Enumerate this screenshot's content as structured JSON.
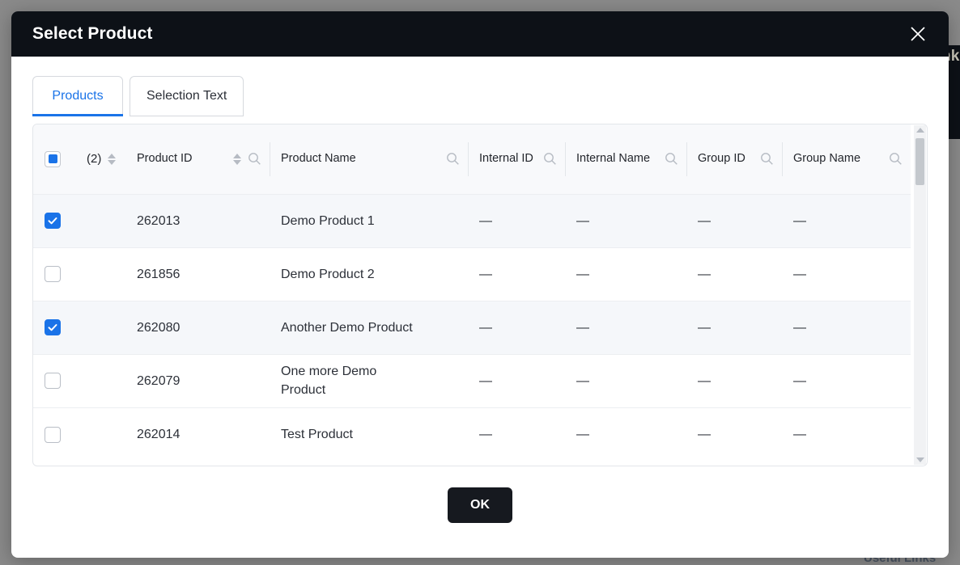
{
  "background": {
    "side_label": "nk",
    "footer_label": "Useful Links"
  },
  "modal": {
    "title": "Select Product",
    "close_icon": "close-icon"
  },
  "tabs": [
    {
      "label": "Products",
      "active": true
    },
    {
      "label": "Selection Text",
      "active": false
    }
  ],
  "table": {
    "selected_count_label": "(2)",
    "columns": [
      {
        "key": "product_id",
        "label": "Product ID",
        "sortable": true,
        "searchable": true
      },
      {
        "key": "product_name",
        "label": "Product Name",
        "sortable": false,
        "searchable": true
      },
      {
        "key": "internal_id",
        "label": "Internal ID",
        "sortable": false,
        "searchable": true
      },
      {
        "key": "internal_name",
        "label": "Internal Name",
        "sortable": false,
        "searchable": true
      },
      {
        "key": "group_id",
        "label": "Group ID",
        "sortable": false,
        "searchable": true
      },
      {
        "key": "group_name",
        "label": "Group Name",
        "sortable": false,
        "searchable": true
      }
    ],
    "rows": [
      {
        "selected": true,
        "product_id": "262013",
        "product_name": "Demo Product 1",
        "internal_id": "—",
        "internal_name": "—",
        "group_id": "—",
        "group_name": "—"
      },
      {
        "selected": false,
        "product_id": "261856",
        "product_name": "Demo Product 2",
        "internal_id": "—",
        "internal_name": "—",
        "group_id": "—",
        "group_name": "—"
      },
      {
        "selected": true,
        "product_id": "262080",
        "product_name": "Another Demo Product",
        "internal_id": "—",
        "internal_name": "—",
        "group_id": "—",
        "group_name": "—"
      },
      {
        "selected": false,
        "product_id": "262079",
        "product_name": "One more Demo Product",
        "internal_id": "—",
        "internal_name": "—",
        "group_id": "—",
        "group_name": "—"
      },
      {
        "selected": false,
        "product_id": "262014",
        "product_name": "Test Product",
        "internal_id": "—",
        "internal_name": "—",
        "group_id": "—",
        "group_name": "—"
      }
    ],
    "header_checkbox_state": "indeterminate"
  },
  "footer": {
    "ok_label": "OK"
  },
  "colors": {
    "accent_blue": "#1a73e8",
    "header_dark": "#0d1117",
    "button_dark": "#16191f",
    "overlay_gray": "#8a8a8a",
    "row_selected": "#f5f7fa"
  }
}
